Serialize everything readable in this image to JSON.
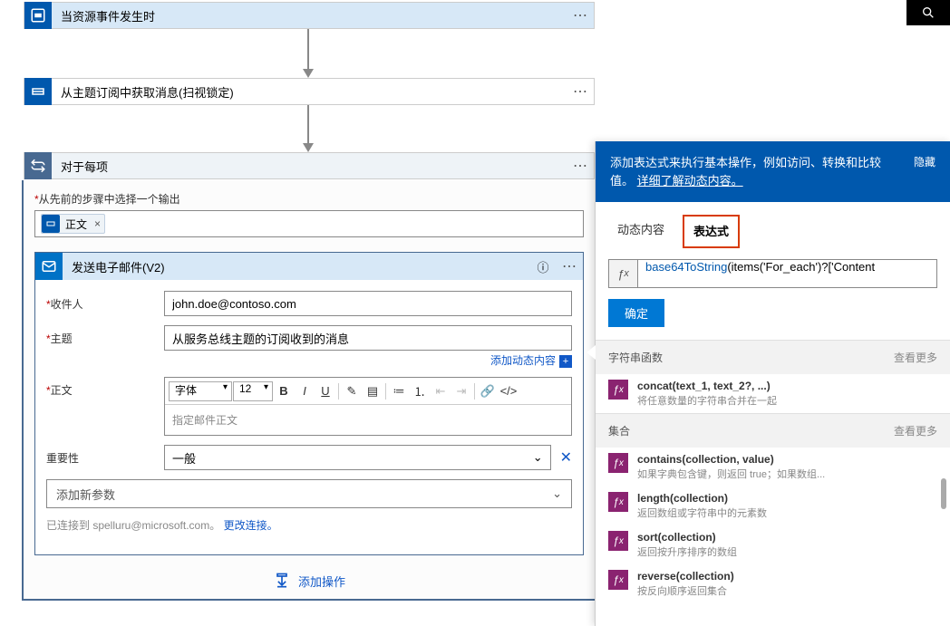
{
  "top_trigger": {
    "title": "当资源事件发生时"
  },
  "step2": {
    "title": "从主题订阅中获取消息(扫视锁定)"
  },
  "foreach": {
    "title": "对于每项",
    "outputs_label": "从先前的步骤中选择一个输出",
    "pill": "正文",
    "pill_x": "×"
  },
  "email": {
    "title": "发送电子邮件(V2)",
    "labels": {
      "to": "收件人",
      "subject": "主题",
      "body": "正文",
      "importance": "重要性"
    },
    "values": {
      "to": "john.doe@contoso.com",
      "subject": "从服务总线主题的订阅收到的消息",
      "body_placeholder": "指定邮件正文",
      "importance": "一般"
    },
    "add_dynamic": "添加动态内容",
    "toolbar": {
      "font": "字体",
      "size": "12"
    },
    "add_param": "添加新参数",
    "connected_prefix": "已连接到 spelluru@microsoft.com。",
    "change_conn": "更改连接。"
  },
  "add_action": "添加操作",
  "panel": {
    "desc_prefix": "添加表达式来执行基本操作，例如访问、转换和比较值。",
    "desc_link": "详细了解动态内容。",
    "hide": "隐藏",
    "tabs": {
      "dynamic": "动态内容",
      "expression": "表达式"
    },
    "fx_value": "base64ToString(items('For_each')?['Content",
    "fx_fn": "base64ToString",
    "fx_rest": "(items('For_each')?['Content",
    "ok": "确定",
    "cat_string": "字符串函数",
    "cat_collection": "集合",
    "see_more": "查看更多",
    "items": {
      "concat": {
        "name": "concat(text_1, text_2?, ...)",
        "desc": "将任意数量的字符串合并在一起"
      },
      "contains": {
        "name": "contains(collection, value)",
        "desc": "如果字典包含键，则返回 true；如果数组..."
      },
      "length": {
        "name": "length(collection)",
        "desc": "返回数组或字符串中的元素数"
      },
      "sort": {
        "name": "sort(collection)",
        "desc": "返回按升序排序的数组"
      },
      "reverse": {
        "name": "reverse(collection)",
        "desc": "按反向顺序返回集合"
      }
    }
  }
}
